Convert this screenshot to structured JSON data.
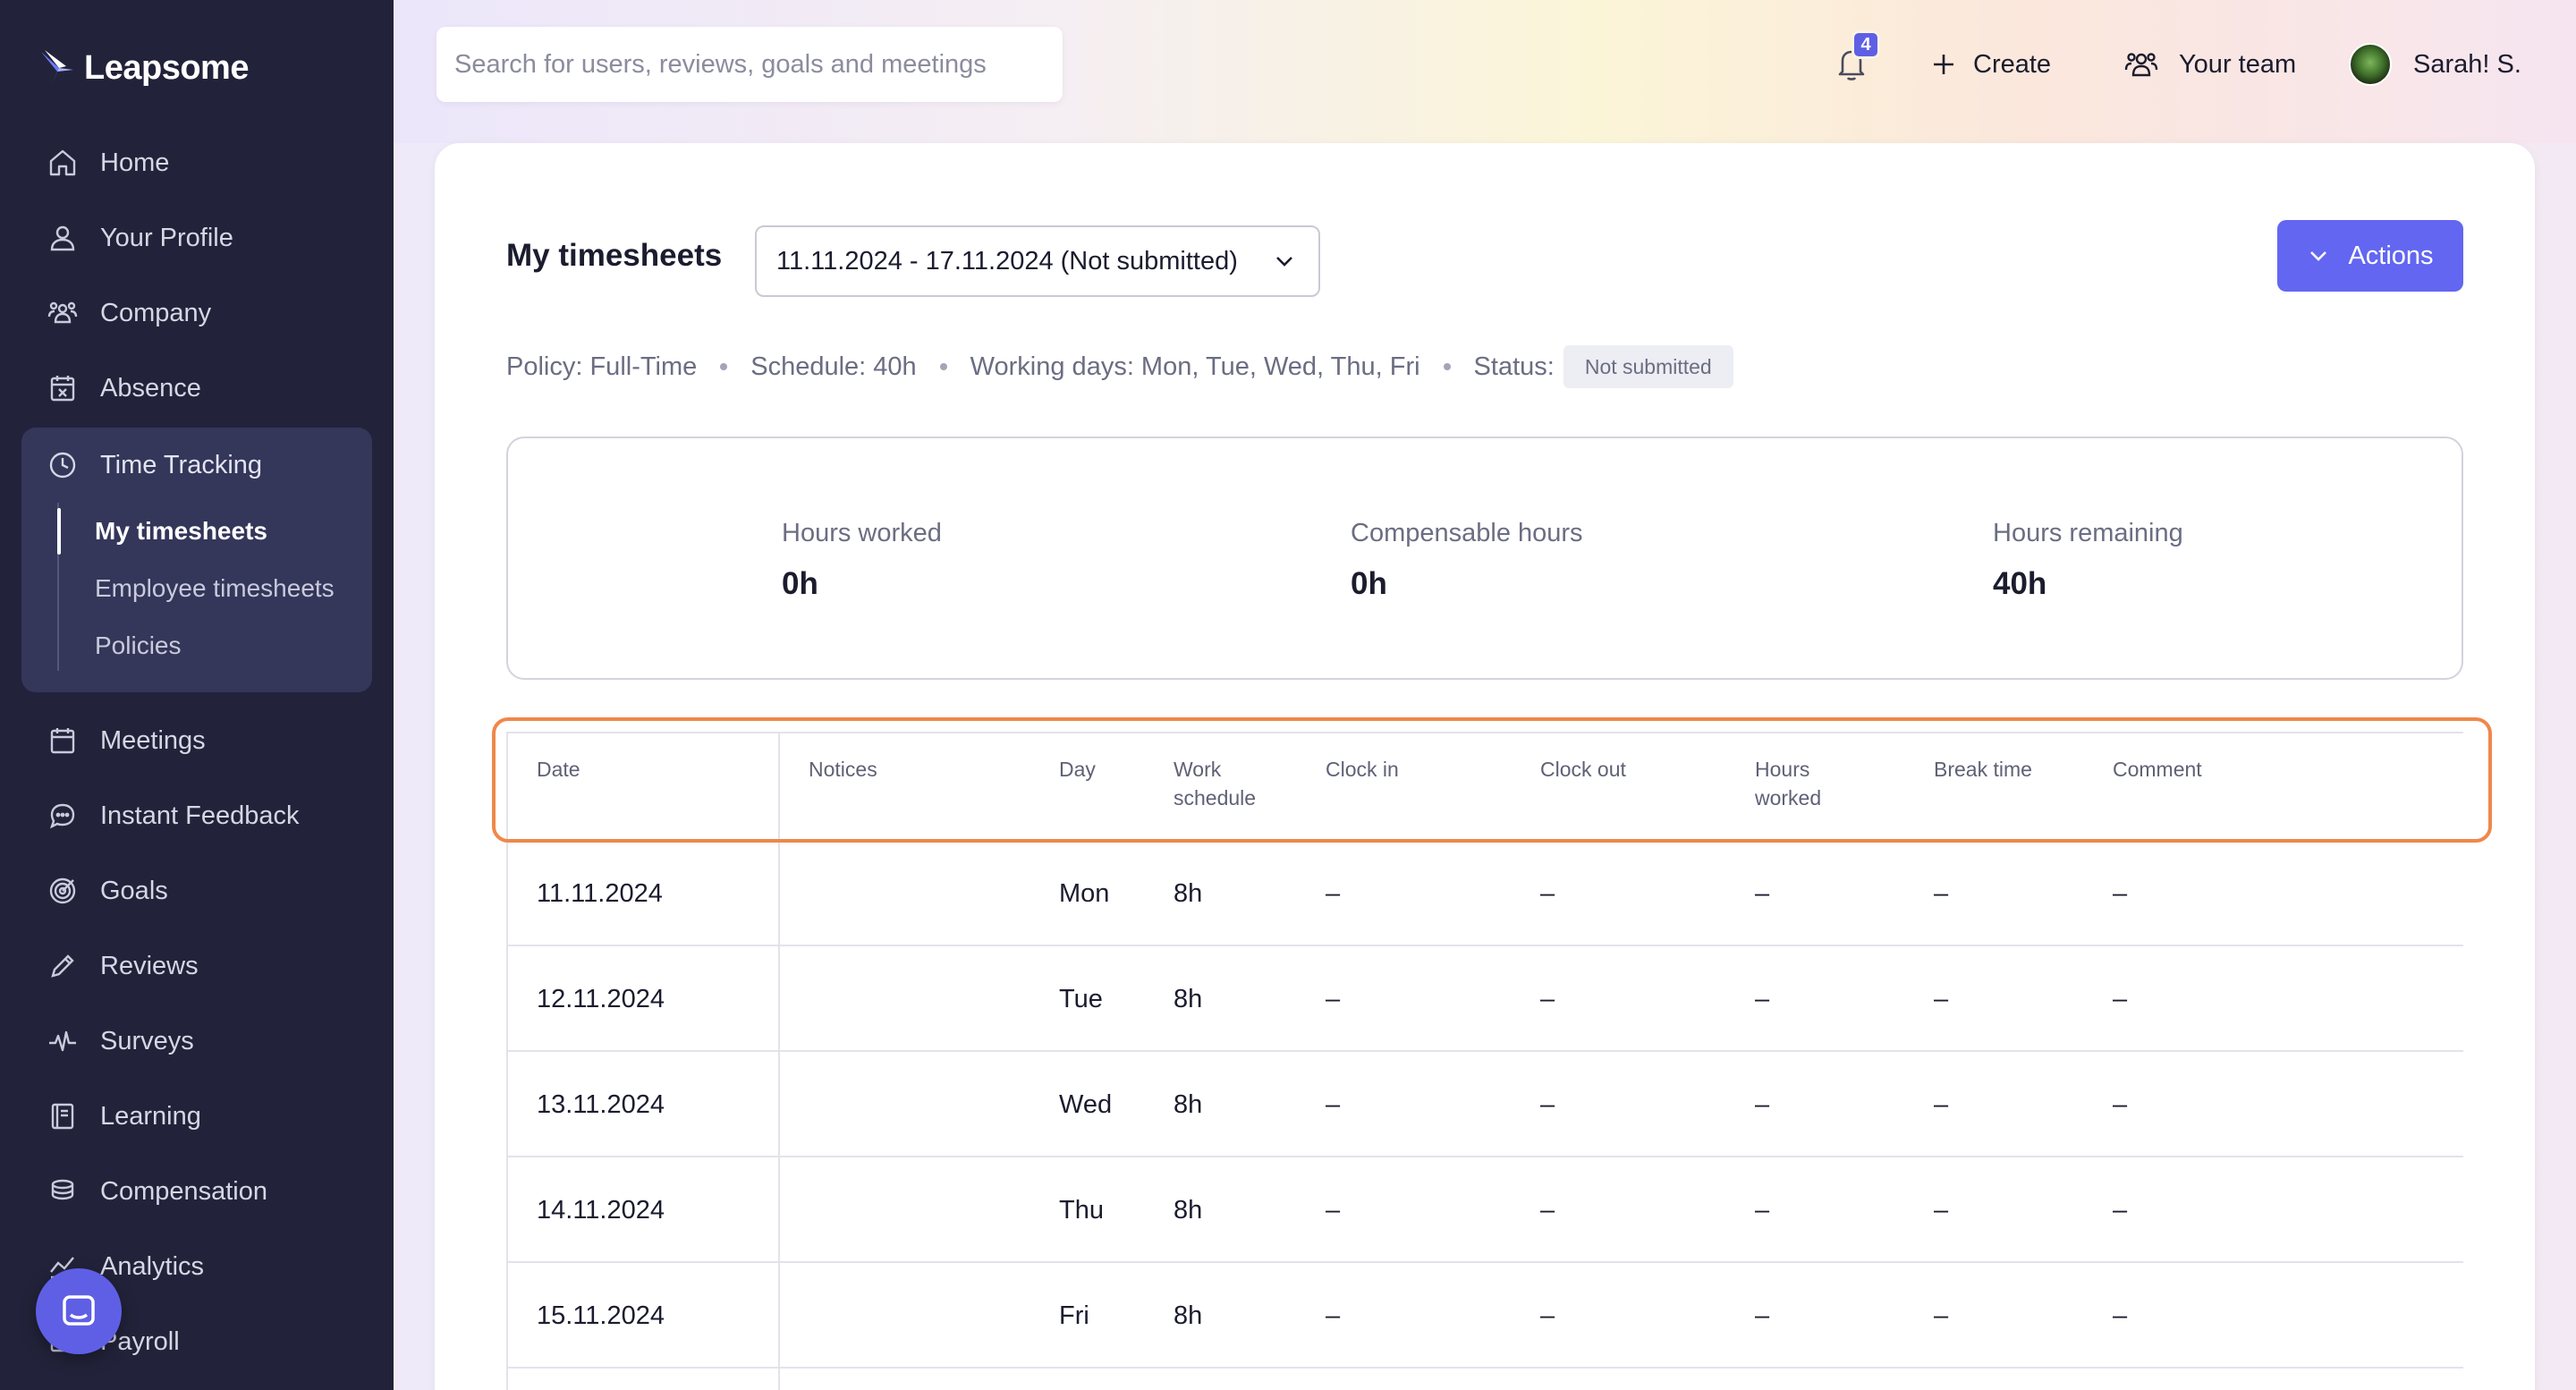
{
  "brand": {
    "name": "Leapsome"
  },
  "sidebar": {
    "items_top": [
      {
        "label": "Home",
        "icon": "home-icon"
      },
      {
        "label": "Your Profile",
        "icon": "user-icon"
      },
      {
        "label": "Company",
        "icon": "people-icon"
      },
      {
        "label": "Absence",
        "icon": "calendar-x-icon"
      }
    ],
    "time_tracking": {
      "label": "Time Tracking",
      "icon": "clock-icon",
      "sub": [
        {
          "label": "My timesheets",
          "active": true
        },
        {
          "label": "Employee timesheets",
          "active": false
        },
        {
          "label": "Policies",
          "active": false
        }
      ]
    },
    "items_bottom": [
      {
        "label": "Meetings",
        "icon": "calendar-icon"
      },
      {
        "label": "Instant Feedback",
        "icon": "chat-icon"
      },
      {
        "label": "Goals",
        "icon": "target-icon"
      },
      {
        "label": "Reviews",
        "icon": "pencil-icon"
      },
      {
        "label": "Surveys",
        "icon": "pulse-icon"
      },
      {
        "label": "Learning",
        "icon": "book-icon"
      },
      {
        "label": "Compensation",
        "icon": "coins-icon"
      },
      {
        "label": "Analytics",
        "icon": "chart-icon"
      },
      {
        "label": "Payroll",
        "icon": "payroll-icon"
      }
    ]
  },
  "topbar": {
    "search_placeholder": "Search for users, reviews, goals and meetings",
    "notifications_count": "4",
    "create_label": "Create",
    "team_label": "Your team",
    "user_name": "Sarah! S."
  },
  "page": {
    "title": "My timesheets",
    "period": "11.11.2024 - 17.11.2024  (Not submitted)",
    "actions_label": "Actions",
    "meta": {
      "policy": "Policy: Full-Time",
      "schedule": "Schedule: 40h",
      "working_days": "Working days: Mon, Tue, Wed, Thu, Fri",
      "status_label": "Status:",
      "status_value": "Not submitted"
    },
    "summary": [
      {
        "label": "Hours worked",
        "value": "0h"
      },
      {
        "label": "Compensable hours",
        "value": "0h"
      },
      {
        "label": "Hours remaining",
        "value": "40h"
      }
    ]
  },
  "table": {
    "headers": {
      "date": "Date",
      "notices": "Notices",
      "day": "Day",
      "work_schedule_1": "Work",
      "work_schedule_2": "schedule",
      "clock_in": "Clock in",
      "clock_out": "Clock out",
      "hours_worked_1": "Hours",
      "hours_worked_2": "worked",
      "break_time": "Break time",
      "comment": "Comment"
    },
    "rows": [
      {
        "date": "11.11.2024",
        "notices": "",
        "day": "Mon",
        "schedule": "8h",
        "clock_in": "–",
        "clock_out": "–",
        "hours": "–",
        "break": "–",
        "comment": "–"
      },
      {
        "date": "12.11.2024",
        "notices": "",
        "day": "Tue",
        "schedule": "8h",
        "clock_in": "–",
        "clock_out": "–",
        "hours": "–",
        "break": "–",
        "comment": "–"
      },
      {
        "date": "13.11.2024",
        "notices": "",
        "day": "Wed",
        "schedule": "8h",
        "clock_in": "–",
        "clock_out": "–",
        "hours": "–",
        "break": "–",
        "comment": "–"
      },
      {
        "date": "14.11.2024",
        "notices": "",
        "day": "Thu",
        "schedule": "8h",
        "clock_in": "–",
        "clock_out": "–",
        "hours": "–",
        "break": "–",
        "comment": "–"
      },
      {
        "date": "15.11.2024",
        "notices": "",
        "day": "Fri",
        "schedule": "8h",
        "clock_in": "–",
        "clock_out": "–",
        "hours": "–",
        "break": "–",
        "comment": "–"
      }
    ]
  },
  "colors": {
    "sidebar_bg": "#22233a",
    "accent": "#6366f1",
    "highlight": "#f0874a"
  }
}
